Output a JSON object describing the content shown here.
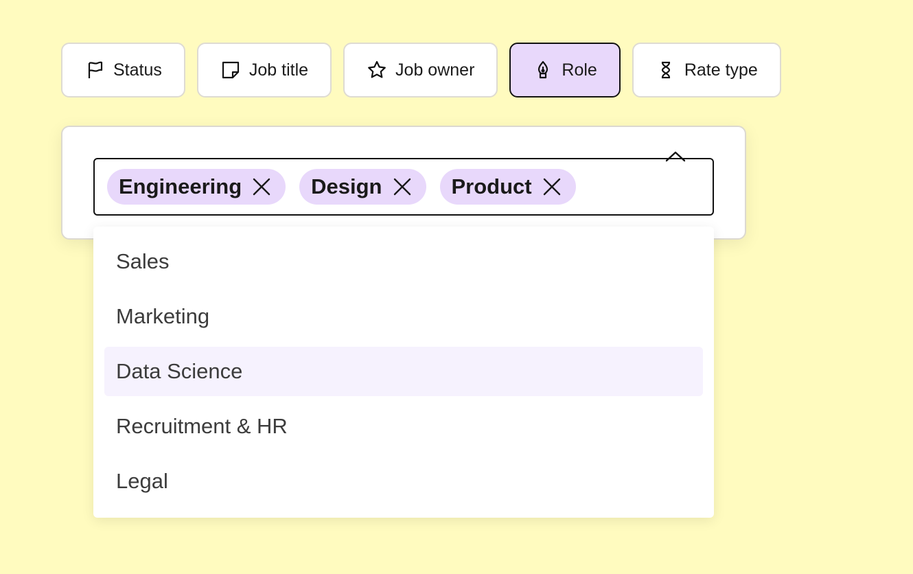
{
  "filters": [
    {
      "label": "Status",
      "icon": "flag-icon",
      "active": false
    },
    {
      "label": "Job title",
      "icon": "note-icon",
      "active": false
    },
    {
      "label": "Job owner",
      "icon": "star-icon",
      "active": false
    },
    {
      "label": "Role",
      "icon": "pen-nib-icon",
      "active": true
    },
    {
      "label": "Rate type",
      "icon": "hourglass-icon",
      "active": false
    }
  ],
  "role_select": {
    "selected_tags": [
      "Engineering",
      "Design",
      "Product"
    ],
    "options": [
      "Sales",
      "Marketing",
      "Data Science",
      "Recruitment & HR",
      "Legal"
    ],
    "hovered_option": "Data Science"
  },
  "colors": {
    "background": "#fffbbf",
    "accent": "#e8d8fb",
    "hover": "#f6f2fe"
  }
}
